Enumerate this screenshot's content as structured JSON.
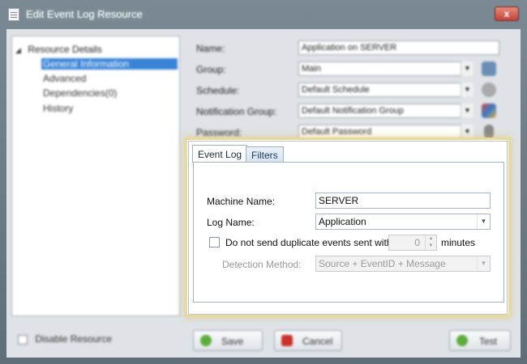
{
  "window": {
    "title": "Edit Event Log Resource",
    "close_label": "x"
  },
  "tree": {
    "root": "Resource Details",
    "items": [
      {
        "label": "General Information",
        "selected": true
      },
      {
        "label": "Advanced"
      },
      {
        "label": "Dependencies(0)"
      },
      {
        "label": "History"
      }
    ]
  },
  "form": {
    "name_label": "Name:",
    "name_value": "Application on SERVER",
    "group_label": "Group:",
    "group_value": "Main",
    "schedule_label": "Schedule:",
    "schedule_value": "Default Schedule",
    "notification_label": "Notification Group:",
    "notification_value": "Default Notification Group",
    "password_label": "Password:",
    "password_value": "Default Password"
  },
  "bottom": {
    "disable_label": "Disable Resource",
    "save_label": "Save",
    "cancel_label": "Cancel",
    "test_label": "Test"
  },
  "panel": {
    "tabs": [
      "Event Log",
      "Filters"
    ],
    "machine_name_label": "Machine Name:",
    "machine_name_value": "SERVER",
    "log_name_label": "Log Name:",
    "log_name_value": "Application",
    "dup_label": "Do not send duplicate events sent within",
    "dup_value": "0",
    "minutes_label": "minutes",
    "detection_label": "Detection Method:",
    "detection_value": "Source + EventID + Message"
  },
  "colors": {
    "selection": "#3a84d8",
    "highlight_frame": "#ead99a"
  }
}
